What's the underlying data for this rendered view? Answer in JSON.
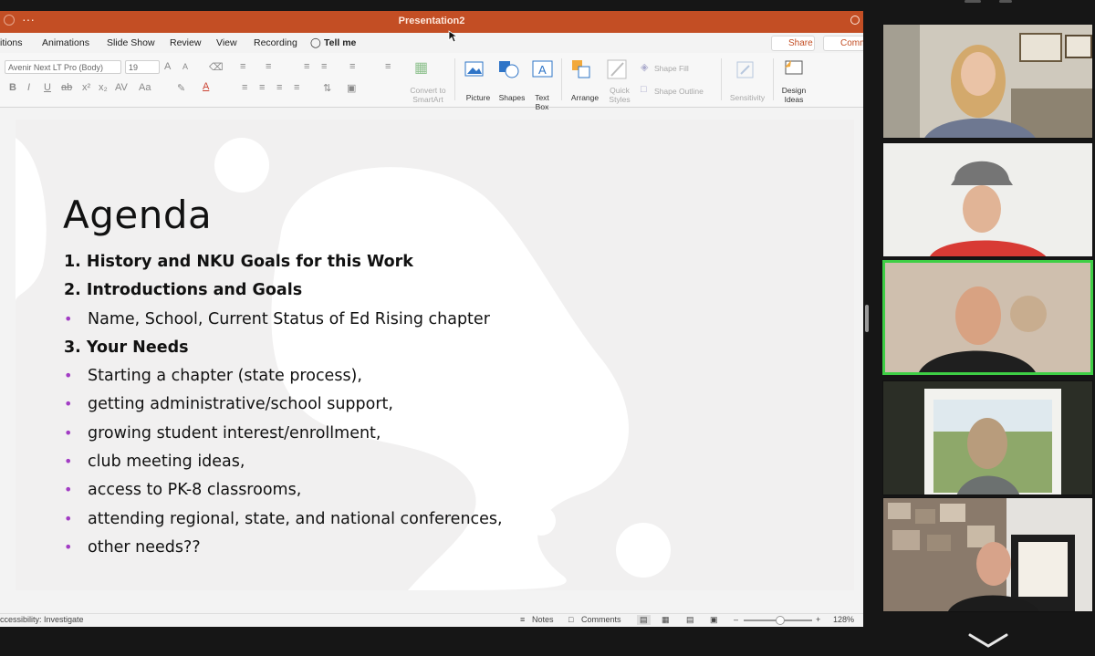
{
  "window": {
    "title": "Presentation2",
    "tabs": [
      "itions",
      "Animations",
      "Slide Show",
      "Review",
      "View",
      "Recording",
      "Tell me"
    ],
    "share_label": "Share",
    "comments_label": "Comm"
  },
  "ribbon": {
    "font_name": "Avenir Next LT Pro (Body)",
    "font_size": "19",
    "convert_smartart": [
      "Convert to",
      "SmartArt"
    ],
    "picture": "Picture",
    "shapes": "Shapes",
    "text_box": [
      "Text",
      "Box"
    ],
    "arrange": "Arrange",
    "quick_styles": [
      "Quick",
      "Styles"
    ],
    "shape_fill": "Shape Fill",
    "shape_outline": "Shape Outline",
    "sensitivity": "Sensitivity",
    "design_ideas": [
      "Design",
      "Ideas"
    ]
  },
  "slide": {
    "title": "Agenda",
    "lines": [
      {
        "kind": "head",
        "text": "1. History and NKU Goals for this Work"
      },
      {
        "kind": "head",
        "text": "2. Introductions and Goals"
      },
      {
        "kind": "bullet",
        "text": "Name, School, Current Status of Ed Rising chapter"
      },
      {
        "kind": "head",
        "text": "3. Your Needs"
      },
      {
        "kind": "bullet",
        "text": "Starting a chapter (state process),"
      },
      {
        "kind": "bullet",
        "text": "getting administrative/school support,"
      },
      {
        "kind": "bullet",
        "text": "growing student interest/enrollment,"
      },
      {
        "kind": "bullet",
        "text": "club meeting ideas,"
      },
      {
        "kind": "bullet",
        "text": "access to PK-8 classrooms,"
      },
      {
        "kind": "bullet",
        "text": "attending regional, state, and national conferences,"
      },
      {
        "kind": "bullet",
        "text": "other needs??"
      }
    ]
  },
  "status": {
    "accessibility": "ccessibility: Investigate",
    "notes": "Notes",
    "comments": "Comments",
    "zoom": "128%"
  },
  "colors": {
    "accent": "#c34e24",
    "bullet": "#a23cc4",
    "active_speaker": "#3ecf45"
  }
}
